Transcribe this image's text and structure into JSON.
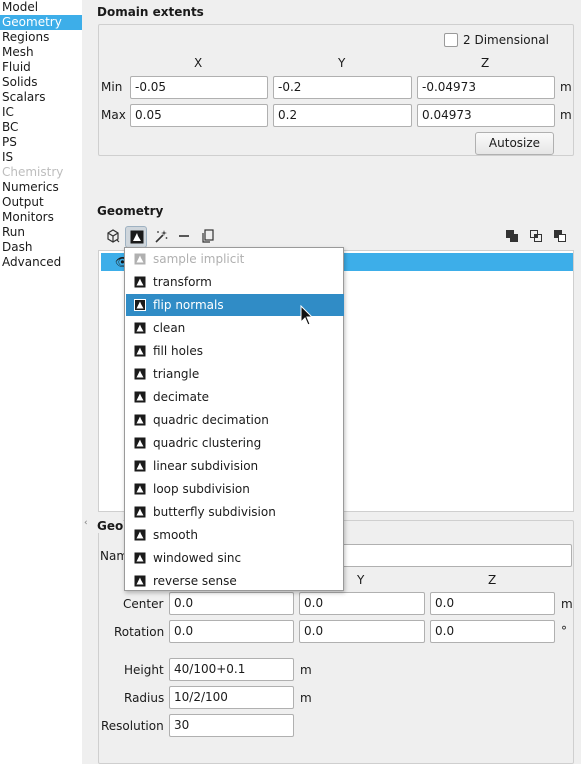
{
  "nav": {
    "items": [
      {
        "label": "Model",
        "state": "normal"
      },
      {
        "label": "Geometry",
        "state": "selected"
      },
      {
        "label": "Regions",
        "state": "normal"
      },
      {
        "label": "Mesh",
        "state": "normal"
      },
      {
        "label": "Fluid",
        "state": "normal"
      },
      {
        "label": "Solids",
        "state": "normal"
      },
      {
        "label": "Scalars",
        "state": "normal"
      },
      {
        "label": "IC",
        "state": "normal"
      },
      {
        "label": "BC",
        "state": "normal"
      },
      {
        "label": "PS",
        "state": "normal"
      },
      {
        "label": "IS",
        "state": "normal"
      },
      {
        "label": "Chemistry",
        "state": "disabled"
      },
      {
        "label": "Numerics",
        "state": "normal"
      },
      {
        "label": "Output",
        "state": "normal"
      },
      {
        "label": "Monitors",
        "state": "normal"
      },
      {
        "label": "Run",
        "state": "normal"
      },
      {
        "label": "Dash",
        "state": "normal"
      },
      {
        "label": "Advanced",
        "state": "normal"
      }
    ]
  },
  "domain": {
    "title": "Domain extents",
    "two_d_label": "2 Dimensional",
    "two_d_checked": false,
    "col_x": "X",
    "col_y": "Y",
    "col_z": "Z",
    "min_label": "Min",
    "max_label": "Max",
    "min": {
      "x": "-0.05",
      "y": "-0.2",
      "z": "-0.04973",
      "unit": "m"
    },
    "max": {
      "x": "0.05",
      "y": "0.2",
      "z": "0.04973",
      "unit": "m"
    },
    "autosize_label": "Autosize"
  },
  "geometry": {
    "title": "Geometry",
    "toolbar_icons": [
      "add-geometry-icon",
      "filter-icon",
      "wand-icon",
      "remove-icon",
      "copy-icon",
      "union-icon",
      "intersect-icon",
      "difference-icon"
    ]
  },
  "menu": {
    "items": [
      {
        "label": "sample implicit",
        "state": "disabled"
      },
      {
        "label": "transform",
        "state": "normal"
      },
      {
        "label": "flip normals",
        "state": "highlight"
      },
      {
        "label": "clean",
        "state": "normal"
      },
      {
        "label": "fill holes",
        "state": "normal"
      },
      {
        "label": "triangle",
        "state": "normal"
      },
      {
        "label": "decimate",
        "state": "normal"
      },
      {
        "label": "quadric decimation",
        "state": "normal"
      },
      {
        "label": "quadric clustering",
        "state": "normal"
      },
      {
        "label": "linear subdivision",
        "state": "normal"
      },
      {
        "label": "loop subdivision",
        "state": "normal"
      },
      {
        "label": "butterfly subdivision",
        "state": "normal"
      },
      {
        "label": "smooth",
        "state": "normal"
      },
      {
        "label": "windowed sinc",
        "state": "normal"
      },
      {
        "label": "reverse sense",
        "state": "normal"
      }
    ]
  },
  "params": {
    "title_visible": "Geo",
    "name_label_visible": "Nam",
    "col_y": "Y",
    "col_z": "Z",
    "center_label": "Center",
    "center": {
      "x": "0.0",
      "y": "0.0",
      "z": "0.0",
      "unit": "m"
    },
    "rotation_label": "Rotation",
    "rotation": {
      "x": "0.0",
      "y": "0.0",
      "z": "0.0",
      "unit": "°"
    },
    "height_label": "Height",
    "height_value": "40/100+0.1",
    "height_unit": "m",
    "radius_label": "Radius",
    "radius_value": "10/2/100",
    "radius_unit": "m",
    "resolution_label": "Resolution",
    "resolution_value": "30"
  }
}
